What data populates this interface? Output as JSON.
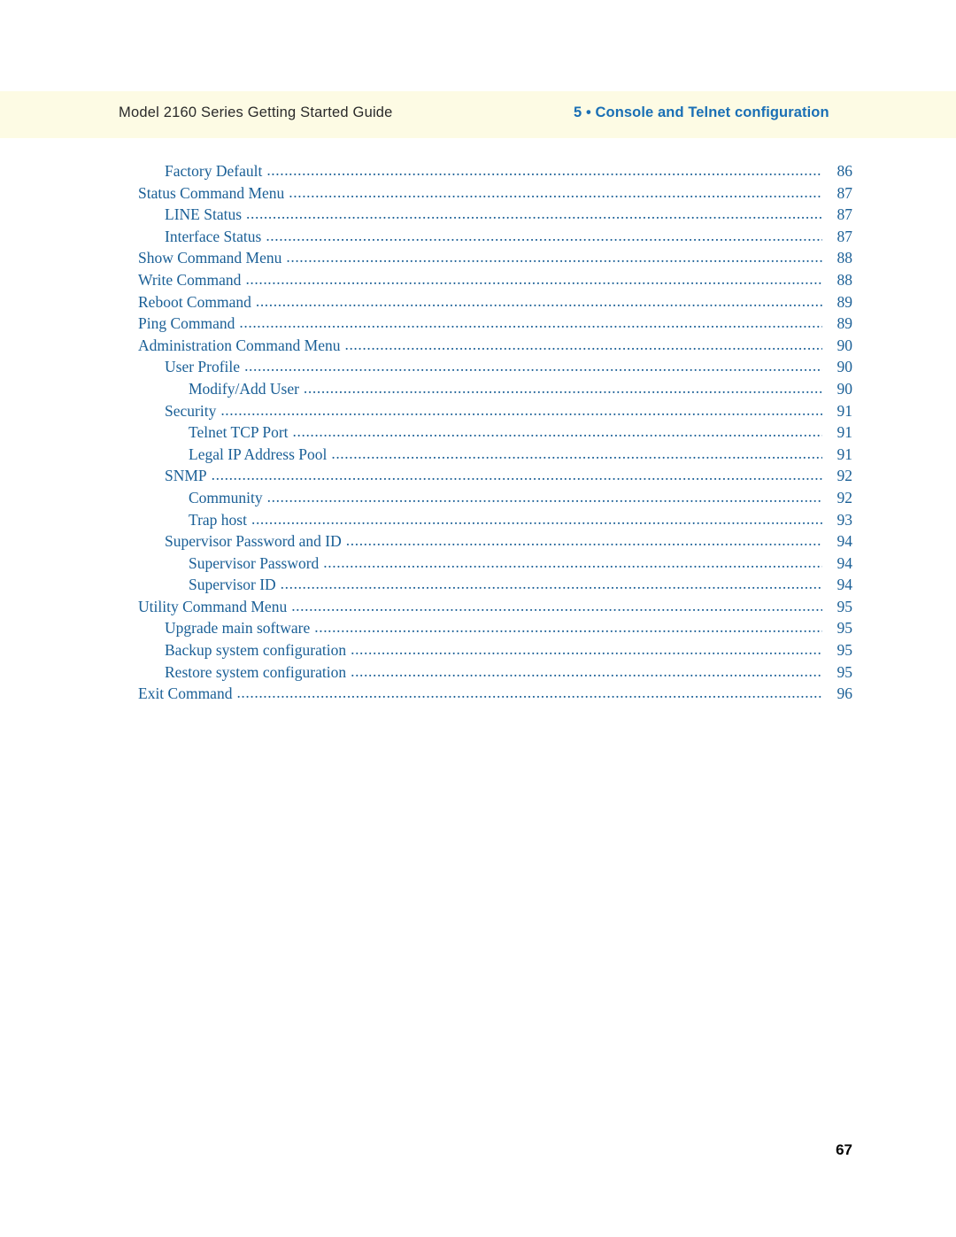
{
  "header": {
    "left_title": "Model 2160 Series Getting Started Guide",
    "right_title": "5 • Console and Telnet configuration"
  },
  "toc": {
    "entries": [
      {
        "label": "Factory Default",
        "page": "86",
        "level": 1
      },
      {
        "label": "Status Command Menu",
        "page": "87",
        "level": 0
      },
      {
        "label": "LINE Status",
        "page": "87",
        "level": 1
      },
      {
        "label": "Interface Status",
        "page": "87",
        "level": 1
      },
      {
        "label": "Show Command Menu",
        "page": "88",
        "level": 0
      },
      {
        "label": "Write Command",
        "page": "88",
        "level": 0
      },
      {
        "label": "Reboot Command",
        "page": "89",
        "level": 0
      },
      {
        "label": "Ping Command",
        "page": "89",
        "level": 0
      },
      {
        "label": "Administration Command Menu",
        "page": "90",
        "level": 0
      },
      {
        "label": "User Profile",
        "page": "90",
        "level": 1
      },
      {
        "label": "Modify/Add User",
        "page": "90",
        "level": 2
      },
      {
        "label": "Security",
        "page": "91",
        "level": 1
      },
      {
        "label": "Telnet TCP Port",
        "page": "91",
        "level": 2
      },
      {
        "label": "Legal IP Address Pool",
        "page": "91",
        "level": 2
      },
      {
        "label": "SNMP",
        "page": "92",
        "level": 1
      },
      {
        "label": "Community",
        "page": "92",
        "level": 2
      },
      {
        "label": "Trap host",
        "page": "93",
        "level": 2
      },
      {
        "label": "Supervisor Password and ID",
        "page": "94",
        "level": 1
      },
      {
        "label": "Supervisor Password",
        "page": "94",
        "level": 2
      },
      {
        "label": "Supervisor ID",
        "page": "94",
        "level": 2
      },
      {
        "label": "Utility Command Menu",
        "page": "95",
        "level": 0
      },
      {
        "label": "Upgrade main software",
        "page": "95",
        "level": 1
      },
      {
        "label": "Backup system configuration",
        "page": "95",
        "level": 1
      },
      {
        "label": "Restore system configuration",
        "page": "95",
        "level": 1
      },
      {
        "label": "Exit Command",
        "page": "96",
        "level": 0
      }
    ],
    "leader": "........................................................................................................................................................................................................"
  },
  "footer": {
    "page_number": "67"
  }
}
